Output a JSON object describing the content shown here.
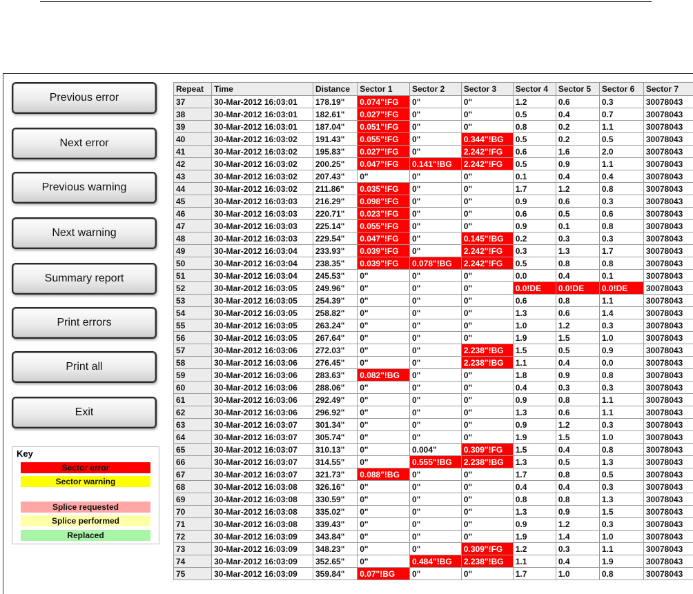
{
  "buttons": {
    "previous_error": "Previous error",
    "next_error": "Next error",
    "previous_warning": "Previous warning",
    "next_warning": "Next warning",
    "summary_report": "Summary report",
    "print_errors": "Print errors",
    "print_all": "Print all",
    "exit": "Exit"
  },
  "key": {
    "title": "Key",
    "items": [
      {
        "label": "Sector error",
        "color": "#ff0000"
      },
      {
        "label": "Sector warning",
        "color": "#ffff00"
      },
      {
        "label": "Splice requested",
        "color": "#ffa6a6"
      },
      {
        "label": "Splice performed",
        "color": "#ffffa8"
      },
      {
        "label": "Replaced",
        "color": "#a8f5a8"
      }
    ]
  },
  "colors": {
    "error": "#ff0000"
  },
  "table": {
    "headers": [
      "Repeat",
      "Time",
      "Distance",
      "Sector 1",
      "Sector 2",
      "Sector 3",
      "Sector 4",
      "Sector 5",
      "Sector 6",
      "Sector 7"
    ],
    "rows": [
      [
        "37",
        "30-Mar-2012 16:03:01",
        "178.19\"",
        "0.074\"!FG",
        "0\"",
        "0\"",
        "1.2",
        "0.6",
        "0.3",
        "30078043"
      ],
      [
        "38",
        "30-Mar-2012 16:03:01",
        "182.61\"",
        "0.027\"!FG",
        "0\"",
        "0\"",
        "0.5",
        "0.4",
        "0.7",
        "30078043"
      ],
      [
        "39",
        "30-Mar-2012 16:03:01",
        "187.04\"",
        "0.051\"!FG",
        "0\"",
        "0\"",
        "0.8",
        "0.2",
        "1.1",
        "30078043"
      ],
      [
        "40",
        "30-Mar-2012 16:03:02",
        "191.43\"",
        "0.055\"!FG",
        "0\"",
        "0.344\"!BG",
        "0.5",
        "0.2",
        "0.5",
        "30078043"
      ],
      [
        "41",
        "30-Mar-2012 16:03:02",
        "195.83\"",
        "0.027\"!FG",
        "0\"",
        "2.242\"!FG",
        "0.6",
        "1.6",
        "2.0",
        "30078043"
      ],
      [
        "42",
        "30-Mar-2012 16:03:02",
        "200.25\"",
        "0.047\"!FG",
        "0.141\"!BG",
        "2.242\"!FG",
        "0.5",
        "0.9",
        "1.1",
        "30078043"
      ],
      [
        "43",
        "30-Mar-2012 16:03:02",
        "207.43\"",
        "0\"",
        "0\"",
        "0\"",
        "0.1",
        "0.4",
        "0.4",
        "30078043"
      ],
      [
        "44",
        "30-Mar-2012 16:03:02",
        "211.86\"",
        "0.035\"!FG",
        "0\"",
        "0\"",
        "1.7",
        "1.2",
        "0.8",
        "30078043"
      ],
      [
        "45",
        "30-Mar-2012 16:03:03",
        "216.29\"",
        "0.098\"!FG",
        "0\"",
        "0\"",
        "0.9",
        "0.6",
        "0.3",
        "30078043"
      ],
      [
        "46",
        "30-Mar-2012 16:03:03",
        "220.71\"",
        "0.023\"!FG",
        "0\"",
        "0\"",
        "0.6",
        "0.5",
        "0.6",
        "30078043"
      ],
      [
        "47",
        "30-Mar-2012 16:03:03",
        "225.14\"",
        "0.055\"!FG",
        "0\"",
        "0\"",
        "0.9",
        "0.1",
        "0.8",
        "30078043"
      ],
      [
        "48",
        "30-Mar-2012 16:03:03",
        "229.54\"",
        "0.047\"!FG",
        "0\"",
        "0.145\"!BG",
        "0.2",
        "0.3",
        "0.3",
        "30078043"
      ],
      [
        "49",
        "30-Mar-2012 16:03:04",
        "233.93\"",
        "0.039\"!FG",
        "0\"",
        "2.242\"!FG",
        "0.3",
        "1.3",
        "1.7",
        "30078043"
      ],
      [
        "50",
        "30-Mar-2012 16:03:04",
        "238.35\"",
        "0.039\"!FG",
        "0.078\"!BG",
        "2.242\"!FG",
        "0.5",
        "0.8",
        "0.8",
        "30078043"
      ],
      [
        "51",
        "30-Mar-2012 16:03:04",
        "245.53\"",
        "0\"",
        "0\"",
        "0\"",
        "0.0",
        "0.4",
        "0.1",
        "30078043"
      ],
      [
        "52",
        "30-Mar-2012 16:03:05",
        "249.96\"",
        "0\"",
        "0\"",
        "0\"",
        "0.0!DE",
        "0.0!DE",
        "0.0!DE",
        "30078043"
      ],
      [
        "53",
        "30-Mar-2012 16:03:05",
        "254.39\"",
        "0\"",
        "0\"",
        "0\"",
        "0.6",
        "0.8",
        "1.1",
        "30078043"
      ],
      [
        "54",
        "30-Mar-2012 16:03:05",
        "258.82\"",
        "0\"",
        "0\"",
        "0\"",
        "1.3",
        "0.6",
        "1.4",
        "30078043"
      ],
      [
        "55",
        "30-Mar-2012 16:03:05",
        "263.24\"",
        "0\"",
        "0\"",
        "0\"",
        "1.0",
        "1.2",
        "0.3",
        "30078043"
      ],
      [
        "56",
        "30-Mar-2012 16:03:05",
        "267.64\"",
        "0\"",
        "0\"",
        "0\"",
        "1.9",
        "1.5",
        "1.0",
        "30078043"
      ],
      [
        "57",
        "30-Mar-2012 16:03:06",
        "272.03\"",
        "0\"",
        "0\"",
        "2.238\"!BG",
        "1.5",
        "0.5",
        "0.9",
        "30078043"
      ],
      [
        "58",
        "30-Mar-2012 16:03:06",
        "276.45\"",
        "0\"",
        "0\"",
        "2.238\"!BG",
        "1.1",
        "0.4",
        "0.0",
        "30078043"
      ],
      [
        "59",
        "30-Mar-2012 16:03:06",
        "283.63\"",
        "0.082\"!BG",
        "0\"",
        "0\"",
        "1.8",
        "0.9",
        "0.8",
        "30078043"
      ],
      [
        "60",
        "30-Mar-2012 16:03:06",
        "288.06\"",
        "0\"",
        "0\"",
        "0\"",
        "0.4",
        "0.3",
        "0.3",
        "30078043"
      ],
      [
        "61",
        "30-Mar-2012 16:03:06",
        "292.49\"",
        "0\"",
        "0\"",
        "0\"",
        "0.9",
        "0.8",
        "1.1",
        "30078043"
      ],
      [
        "62",
        "30-Mar-2012 16:03:06",
        "296.92\"",
        "0\"",
        "0\"",
        "0\"",
        "1.3",
        "0.6",
        "1.1",
        "30078043"
      ],
      [
        "63",
        "30-Mar-2012 16:03:07",
        "301.34\"",
        "0\"",
        "0\"",
        "0\"",
        "0.9",
        "1.2",
        "0.3",
        "30078043"
      ],
      [
        "64",
        "30-Mar-2012 16:03:07",
        "305.74\"",
        "0\"",
        "0\"",
        "0\"",
        "1.9",
        "1.5",
        "1.0",
        "30078043"
      ],
      [
        "65",
        "30-Mar-2012 16:03:07",
        "310.13\"",
        "0\"",
        "0.004\"",
        "0.309\"!FG",
        "1.5",
        "0.4",
        "0.8",
        "30078043"
      ],
      [
        "66",
        "30-Mar-2012 16:03:07",
        "314.55\"",
        "0\"",
        "0.555\"!BG",
        "2.238\"!BG",
        "1.3",
        "0.5",
        "1.3",
        "30078043"
      ],
      [
        "67",
        "30-Mar-2012 16:03:07",
        "321.73\"",
        "0.088\"!BG",
        "0\"",
        "0\"",
        "1.7",
        "0.8",
        "0.5",
        "30078043"
      ],
      [
        "68",
        "30-Mar-2012 16:03:08",
        "326.16\"",
        "0\"",
        "0\"",
        "0\"",
        "0.4",
        "0.4",
        "0.3",
        "30078043"
      ],
      [
        "69",
        "30-Mar-2012 16:03:08",
        "330.59\"",
        "0\"",
        "0\"",
        "0\"",
        "0.8",
        "0.8",
        "1.3",
        "30078043"
      ],
      [
        "70",
        "30-Mar-2012 16:03:08",
        "335.02\"",
        "0\"",
        "0\"",
        "0\"",
        "1.3",
        "0.9",
        "1.5",
        "30078043"
      ],
      [
        "71",
        "30-Mar-2012 16:03:08",
        "339.43\"",
        "0\"",
        "0\"",
        "0\"",
        "0.9",
        "1.2",
        "0.3",
        "30078043"
      ],
      [
        "72",
        "30-Mar-2012 16:03:09",
        "343.84\"",
        "0\"",
        "0\"",
        "0\"",
        "1.9",
        "1.4",
        "1.0",
        "30078043"
      ],
      [
        "73",
        "30-Mar-2012 16:03:09",
        "348.23\"",
        "0\"",
        "0\"",
        "0.309\"!FG",
        "1.2",
        "0.3",
        "1.1",
        "30078043"
      ],
      [
        "74",
        "30-Mar-2012 16:03:09",
        "352.65\"",
        "0\"",
        "0.484\"!BG",
        "2.238\"!BG",
        "1.1",
        "0.4",
        "1.9",
        "30078043"
      ],
      [
        "75",
        "30-Mar-2012 16:03:09",
        "359.84\"",
        "0.07\"!BG",
        "0\"",
        "0\"",
        "1.7",
        "1.0",
        "0.8",
        "30078043"
      ]
    ]
  }
}
